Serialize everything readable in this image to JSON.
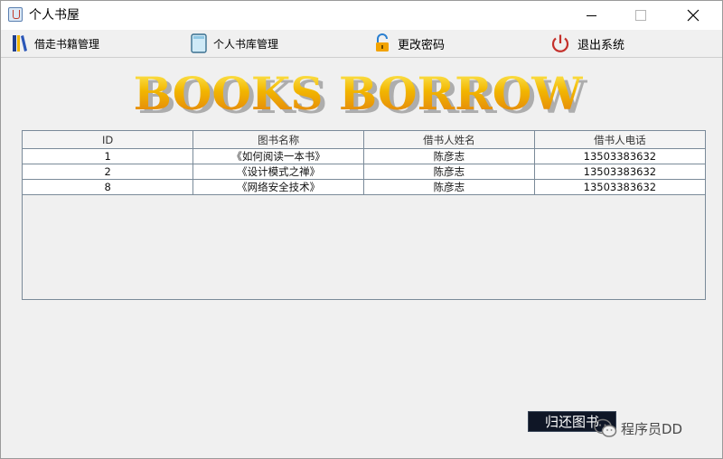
{
  "window": {
    "title": "个人书屋"
  },
  "menu": {
    "borrow": "借走书籍管理",
    "library": "个人书库管理",
    "password": "更改密码",
    "exit": "退出系统"
  },
  "banner": {
    "text": "BOOKS BORROW"
  },
  "table": {
    "headers": [
      "ID",
      "图书名称",
      "借书人姓名",
      "借书人电话"
    ],
    "rows": [
      [
        "1",
        "《如何阅读一本书》",
        "陈彦志",
        "13503383632"
      ],
      [
        "2",
        "《设计模式之禅》",
        "陈彦志",
        "13503383632"
      ],
      [
        "8",
        "《网络安全技术》",
        "陈彦志",
        "13503383632"
      ]
    ]
  },
  "actions": {
    "return_label": "归还图书"
  },
  "watermark": {
    "text": "程序员DD"
  },
  "colors": {
    "banner_gold": "#f2b600",
    "banner_orange": "#e07a10",
    "button_bg": "#0f1626"
  },
  "icons": {
    "borrow": "books-icon",
    "library": "book-icon",
    "password": "lock-icon",
    "exit": "power-icon"
  }
}
